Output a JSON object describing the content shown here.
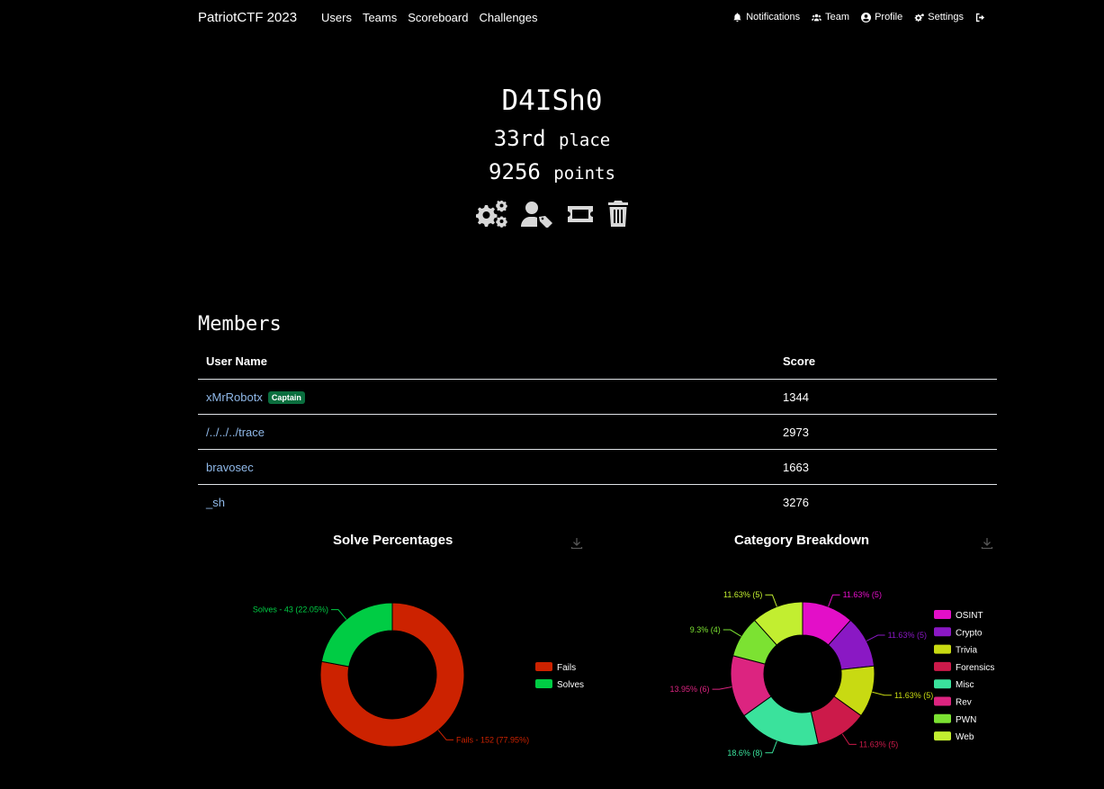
{
  "nav": {
    "brand": "PatriotCTF 2023",
    "links": [
      "Users",
      "Teams",
      "Scoreboard",
      "Challenges"
    ],
    "right": {
      "notifications": "Notifications",
      "team": "Team",
      "profile": "Profile",
      "settings": "Settings"
    }
  },
  "team": {
    "name": "D4ISh0",
    "place_value": "33rd",
    "place_word": "place",
    "points_value": "9256",
    "points_word": "points"
  },
  "members": {
    "title": "Members",
    "headers": {
      "name": "User Name",
      "score": "Score"
    },
    "captain_badge": "Captain",
    "rows": [
      {
        "name": "xMrRobotx",
        "score": "1344"
      },
      {
        "name": "/../../../trace",
        "score": "2973"
      },
      {
        "name": "bravosec",
        "score": "1663"
      },
      {
        "name": "_sh",
        "score": "3276"
      }
    ]
  },
  "chart_data": [
    {
      "type": "pie",
      "title": "Solve Percentages",
      "legend_position": "right",
      "slices": [
        {
          "name": "Fails",
          "value": 152,
          "percent": 77.95,
          "label": "Fails - 152 (77.95%)",
          "color": "#cc2200"
        },
        {
          "name": "Solves",
          "value": 43,
          "percent": 22.05,
          "label": "Solves - 43 (22.05%)",
          "color": "#00cc44"
        }
      ]
    },
    {
      "type": "pie",
      "title": "Category Breakdown",
      "legend_position": "right",
      "slices": [
        {
          "name": "OSINT",
          "value": 5,
          "percent": 11.63,
          "label": "11.63% (5)",
          "color": "#e30fc8"
        },
        {
          "name": "Crypto",
          "value": 5,
          "percent": 11.63,
          "label": "11.63% (5)",
          "color": "#8a18c4"
        },
        {
          "name": "Trivia",
          "value": 5,
          "percent": 11.63,
          "label": "11.63% (5)",
          "color": "#c8da12"
        },
        {
          "name": "Forensics",
          "value": 5,
          "percent": 11.63,
          "label": "11.63% (5)",
          "color": "#cc1a4a"
        },
        {
          "name": "Misc",
          "value": 8,
          "percent": 18.6,
          "label": "18.6% (8)",
          "color": "#3ae29c"
        },
        {
          "name": "Rev",
          "value": 6,
          "percent": 13.95,
          "label": "13.95% (6)",
          "color": "#dc2480"
        },
        {
          "name": "PWN",
          "value": 4,
          "percent": 9.3,
          "label": "9.3% (4)",
          "color": "#7ce232"
        },
        {
          "name": "Web",
          "value": 5,
          "percent": 11.63,
          "label": "11.63% (5)",
          "color": "#c2ee30"
        }
      ]
    }
  ]
}
